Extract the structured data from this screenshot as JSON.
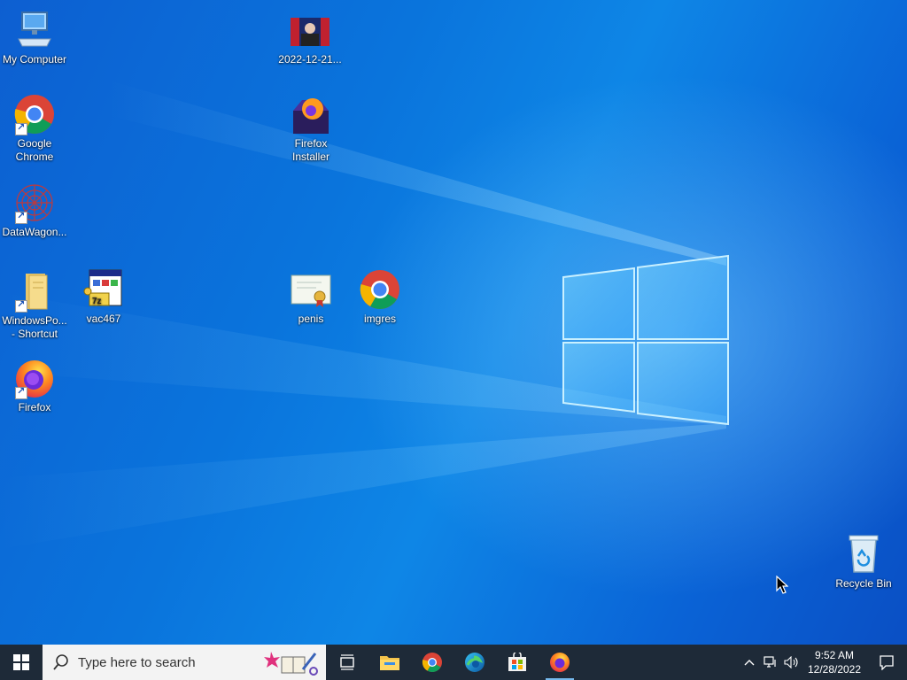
{
  "desktop": {
    "icons": [
      {
        "label": "My Computer",
        "icon": "computer-icon"
      },
      {
        "label": "Google Chrome",
        "icon": "chrome-icon",
        "shortcut": true
      },
      {
        "label": "DataWagon...",
        "icon": "datawagon-icon",
        "shortcut": true
      },
      {
        "label": "WindowsPo... - Shortcut",
        "icon": "folder-icon",
        "shortcut": true
      },
      {
        "label": "vac467",
        "icon": "installer-icon"
      },
      {
        "label": "Firefox",
        "icon": "firefox-icon",
        "shortcut": true
      },
      {
        "label": "2022-12-21...",
        "icon": "image-thumbnail-icon"
      },
      {
        "label": "Firefox Installer",
        "icon": "firefox-installer-icon"
      },
      {
        "label": "penis",
        "icon": "certificate-icon"
      },
      {
        "label": "imgres",
        "icon": "chrome-icon"
      },
      {
        "label": "Recycle Bin",
        "icon": "recycle-bin-icon"
      }
    ]
  },
  "taskbar": {
    "search_placeholder": "Type here to search",
    "pinned": [
      {
        "name": "task-view",
        "icon": "task-view-icon"
      },
      {
        "name": "file-explorer",
        "icon": "folder-icon"
      },
      {
        "name": "chrome",
        "icon": "chrome-icon"
      },
      {
        "name": "edge",
        "icon": "edge-icon"
      },
      {
        "name": "store",
        "icon": "store-icon"
      },
      {
        "name": "firefox",
        "icon": "firefox-icon"
      }
    ],
    "clock": {
      "time": "9:52 AM",
      "date": "12/28/2022"
    }
  },
  "colors": {
    "desktop_blue": "#0a74dc",
    "taskbar": "#1e2a38",
    "search_box": "#f3f3f3"
  }
}
